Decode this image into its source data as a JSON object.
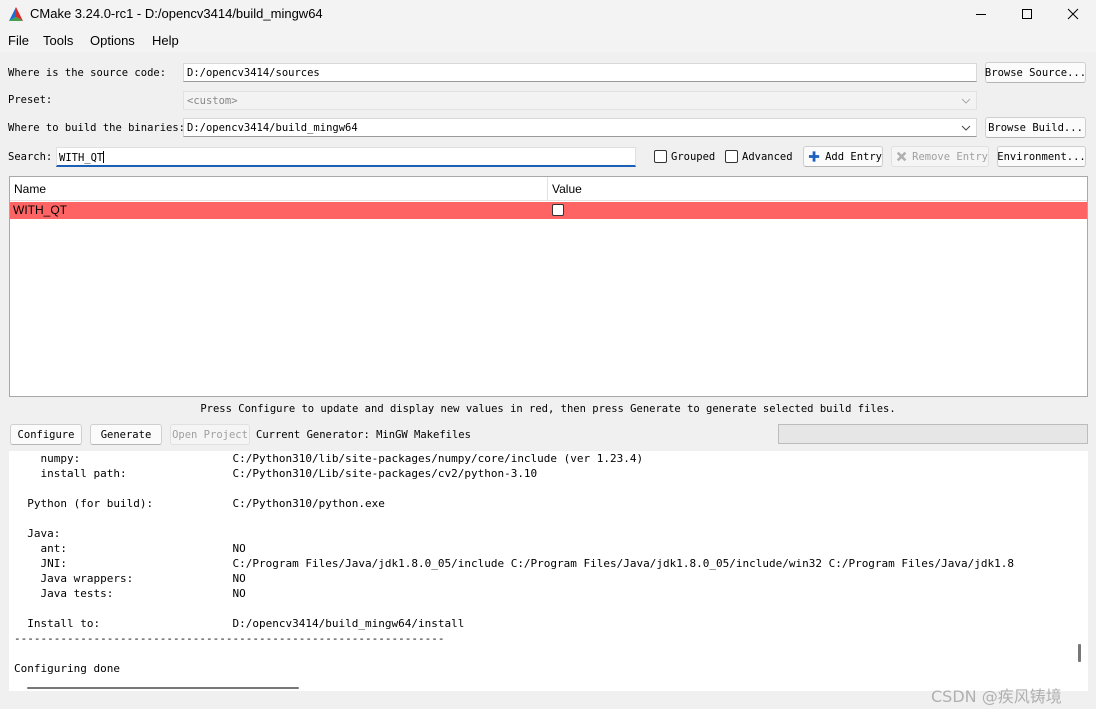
{
  "window": {
    "title": "CMake 3.24.0-rc1 - D:/opencv3414/build_mingw64",
    "controls": {
      "minimize": "minimize-icon",
      "maximize": "maximize-icon",
      "close": "close-icon"
    }
  },
  "menu": {
    "file": "File",
    "tools": "Tools",
    "options": "Options",
    "help": "Help"
  },
  "config": {
    "source_label": "Where is the source code:",
    "source_value": "D:/opencv3414/sources",
    "browse_source": "Browse Source...",
    "preset_label": "Preset:",
    "preset_value": "<custom>",
    "binaries_label": "Where to build the binaries:",
    "binaries_value": "D:/opencv3414/build_mingw64",
    "browse_build": "Browse Build..."
  },
  "search": {
    "label": "Search:",
    "value": "WITH_QT",
    "grouped_label": "Grouped",
    "grouped_checked": false,
    "advanced_label": "Advanced",
    "advanced_checked": false,
    "add_entry": "Add Entry",
    "remove_entry": "Remove Entry",
    "environment": "Environment..."
  },
  "table": {
    "columns": [
      "Name",
      "Value"
    ],
    "rows": [
      {
        "name": "WITH_QT",
        "value_checked": false,
        "highlight_color": "#ff6464"
      }
    ]
  },
  "hint": "Press Configure to update and display new values in red, then press Generate to generate selected build files.",
  "actions": {
    "configure": "Configure",
    "generate": "Generate",
    "open_project": "Open Project",
    "current_generator": "Current Generator: MinGW Makefiles"
  },
  "output": {
    "lines": [
      "    numpy:                       C:/Python310/lib/site-packages/numpy/core/include (ver 1.23.4)",
      "    install path:                C:/Python310/Lib/site-packages/cv2/python-3.10",
      "",
      "  Python (for build):            C:/Python310/python.exe",
      "",
      "  Java:",
      "    ant:                         NO",
      "    JNI:                         C:/Program Files/Java/jdk1.8.0_05/include C:/Program Files/Java/jdk1.8.0_05/include/win32 C:/Program Files/Java/jdk1.8",
      "    Java wrappers:               NO",
      "    Java tests:                  NO",
      "",
      "  Install to:                    D:/opencv3414/build_mingw64/install",
      "-----------------------------------------------------------------",
      "",
      "Configuring done"
    ]
  },
  "watermark": "CSDN @疾风铸境",
  "colors": {
    "highlight_row": "#ff6464",
    "search_underline": "#1a5fb4",
    "add_icon": "#1f5fbf"
  }
}
